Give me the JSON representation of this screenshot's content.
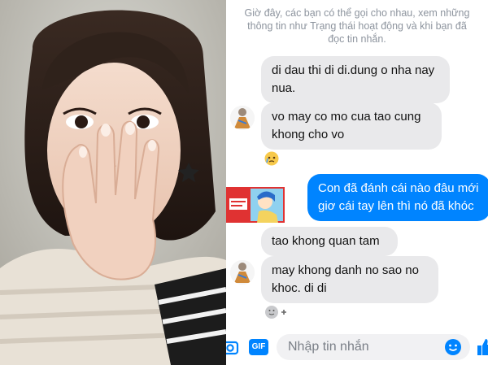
{
  "photo": {
    "description_icon": "woman-photo"
  },
  "chat": {
    "notice_line1": "Giờ đây, các bạn có thể gọi cho nhau, xem những",
    "notice_line2": "thông tin như Trạng thái hoạt động và khi bạn đã",
    "notice_line3": "đọc tin nhắn.",
    "messages": [
      {
        "direction": "incoming",
        "lines": [
          "di dau thi di di.dung o nha nay",
          "nua."
        ]
      },
      {
        "direction": "incoming",
        "lines": [
          "vo may co mo cua tao cung",
          "khong cho vo"
        ]
      },
      {
        "direction": "outgoing",
        "lines": [
          "Con đã đánh cái nào đâu mới",
          "giơ cái tay lên thì nó đã khóc"
        ]
      },
      {
        "direction": "incoming",
        "lines": [
          "tao khong quan tam"
        ]
      },
      {
        "direction": "incoming",
        "lines": [
          "may khong danh no sao no",
          "khoc. di di"
        ]
      }
    ],
    "composer": {
      "placeholder": "Nhập tin nhắn",
      "gif_label": "GIF"
    }
  },
  "colors": {
    "accent": "#0084ff",
    "bubble_in": "#e9e9eb"
  }
}
